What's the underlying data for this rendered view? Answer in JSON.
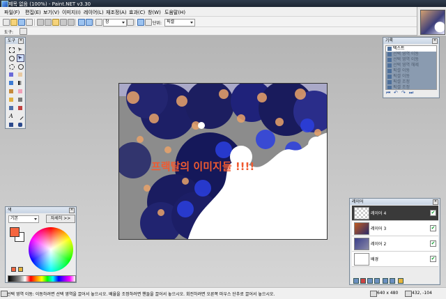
{
  "window": {
    "title": "제목 없음 (100%) - Paint.NET v3.30"
  },
  "menu": [
    "파일(F)",
    "편집(E)",
    "보기(V)",
    "이미지(I)",
    "레이어(L)",
    "재조정(A)",
    "효과(C)",
    "창(W)",
    "도움말(H)"
  ],
  "toolbar": {
    "zoom_value": "창",
    "units_label": "단위:",
    "units_value": "픽셀",
    "tool_label": "도구:"
  },
  "canvas": {
    "overlay_text": "프랙탈의 이미지들 !!!!"
  },
  "panels": {
    "tools": {
      "title": "도구"
    },
    "history": {
      "title": "기록",
      "items": [
        "텍스트",
        "선택 영역 이동",
        "선택 영역 이동",
        "선택 영역 해제",
        "픽셀 이동",
        "픽셀 이동",
        "픽셀 조정",
        "픽셀 조정",
        "픽셀 조정"
      ]
    },
    "colors": {
      "title": "색",
      "mode": "기본",
      "more_button": "자세히 >>",
      "primary_color": "#f5653f",
      "secondary_color": "#ffffff"
    },
    "layers": {
      "title": "레이어",
      "items": [
        {
          "name": "레이어 4",
          "visible": true,
          "selected": true
        },
        {
          "name": "레이어 3",
          "visible": true,
          "selected": false
        },
        {
          "name": "레이어 2",
          "visible": true,
          "selected": false
        },
        {
          "name": "배경",
          "visible": true,
          "selected": false
        }
      ]
    }
  },
  "status": {
    "message": "선택 영역 이동: 이동하려면 선택 영역을 끌어서 놓으시오. 배율을 조정하려면 핸들을 끌어서 놓으시오. 회전하려면 오른쪽 마우스 단추로 끌어서 놓으시오.",
    "image_size": "640 x 480",
    "cursor_position": "432, -104"
  }
}
